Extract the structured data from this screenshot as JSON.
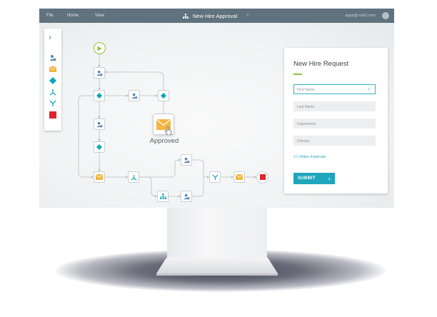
{
  "menu": {
    "file": "File",
    "home": "Home",
    "view": "View"
  },
  "workflow_title": "New Hire Approval",
  "close_glyph": "×",
  "user_email": "apps@ nyk2.com",
  "canvas": {
    "approved_label": "Approved"
  },
  "form": {
    "title": "New Hire Request",
    "fields": [
      "First Name",
      "Last Name",
      "Department",
      "Division"
    ],
    "make_duplicate": "(+) Make duplicate",
    "submit_label": "SUBMIT"
  },
  "colors": {
    "titlebar": "#60727d",
    "accent": "#1fa6bd",
    "diamond": "#0fa6b8",
    "mail": "#f3b640",
    "stop": "#e0242f",
    "start": "#8cc23a",
    "user": "#4a86c5"
  }
}
